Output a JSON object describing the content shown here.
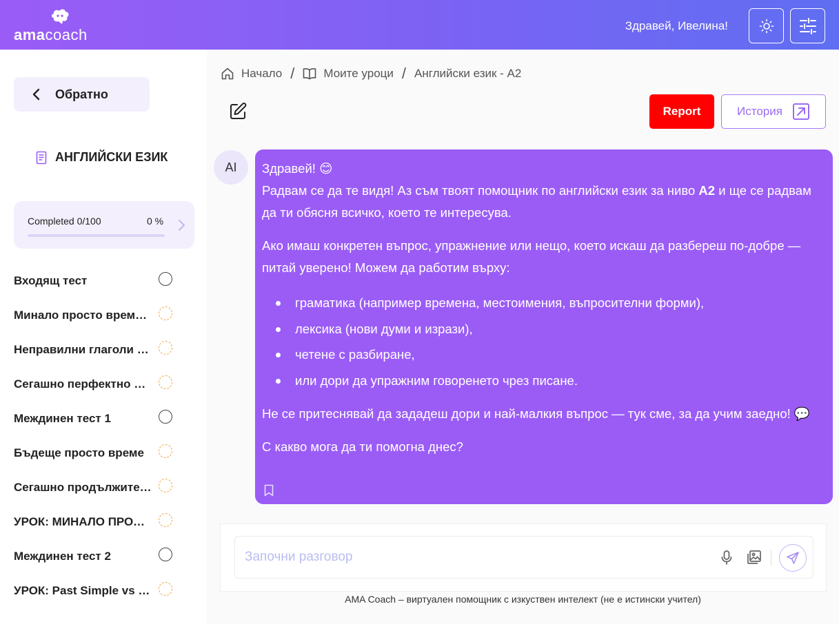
{
  "header": {
    "logo_bold": "ama",
    "logo_light": "coach",
    "greeting": "Здравей, Ивелина!",
    "theme_icon": "sun-icon",
    "settings_icon": "sliders-icon",
    "gradient_start": "#9b5cf6",
    "gradient_end": "#5f6ef2"
  },
  "sidebar": {
    "back_label": "Обратно",
    "course_title": "АНГЛИЙСКИ ЕЗИК",
    "progress": {
      "label": "Completed 0/100",
      "percent_text": "0 %",
      "fraction": 0.0
    },
    "lessons": [
      {
        "label": "Входящ тест",
        "status": "not-started"
      },
      {
        "label": "Минало просто време (Past Simple)",
        "status": "in-progress"
      },
      {
        "label": "Неправилни глаголи (Irregular Verbs)",
        "status": "in-progress"
      },
      {
        "label": "Сегашно перфектно време",
        "status": "in-progress"
      },
      {
        "label": "Междинен тест 1",
        "status": "not-started"
      },
      {
        "label": "Бъдеще просто време",
        "status": "in-progress"
      },
      {
        "label": "Сегашно продължително време",
        "status": "in-progress"
      },
      {
        "label": "УРОК: МИНАЛО ПРОДЪЛЖИТЕЛНО",
        "status": "in-progress"
      },
      {
        "label": "Междинен тест 2",
        "status": "not-started"
      },
      {
        "label": "УРОК: Past Simple vs Past Continuous",
        "status": "in-progress"
      }
    ]
  },
  "breadcrumb": {
    "home": "Начало",
    "lessons": "Моите уроци",
    "current": "Английски език - A2"
  },
  "toolbar": {
    "report_label": "Report",
    "history_label": "История",
    "report_color": "#ff0000",
    "accent_color": "#9b5cf6"
  },
  "chat": {
    "avatar_label": "AI",
    "greeting_line": "Здравей! 😊",
    "intro_before": "Радвам се да те видя! Аз съм твоят помощник по английски език за ниво ",
    "intro_level": "A2",
    "intro_after": " и ще се радвам да ти обясня всичко, което те интересува.",
    "question_line": "Ако имаш конкретен въпрос, упражнение или нещо, което искаш да разбереш по-добре — питай уверено! Можем да работим върху:",
    "topics": [
      "граматика (например времена, местоимения, въпросителни форми),",
      "лексика (нови думи и изрази),",
      "четене с разбиране,",
      "или дори да упражним говоренето чрез писане."
    ],
    "encourage_line": "Не се притеснявай да зададеш дори и най-малкия въпрос — тук сме, за да учим заедно! 💬",
    "closing_line": "С какво мога да ти помогна днес?"
  },
  "composer": {
    "placeholder": "Започни разговор",
    "value": ""
  },
  "footer_note": "AMA Coach – виртуален помощник с изкуствен интелект (не е истински учител)"
}
